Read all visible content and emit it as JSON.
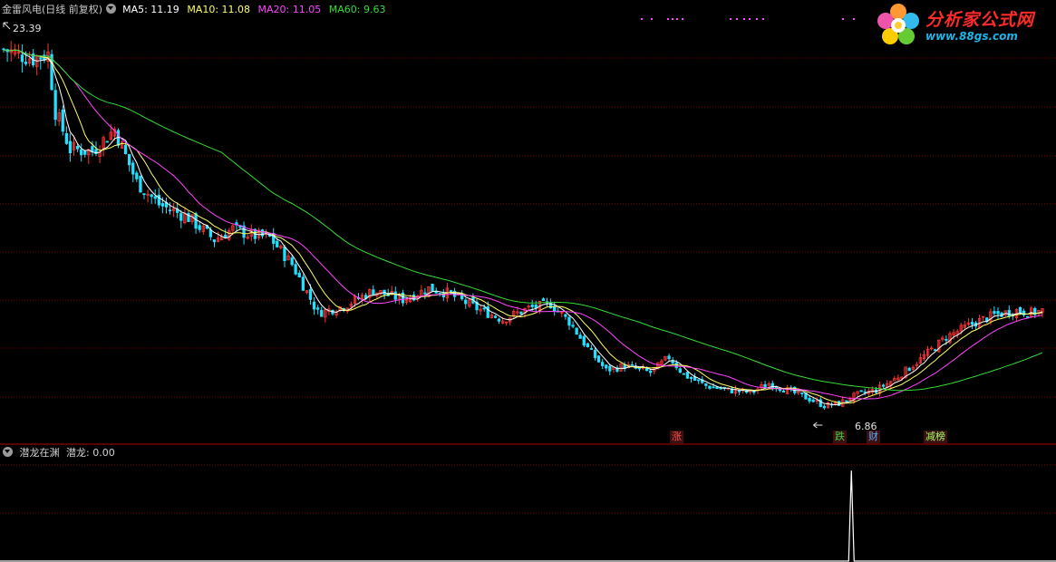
{
  "header": {
    "stock_name": "金雷风电(日线 前复权)",
    "ma5_label": "MA5: 11.19",
    "ma10_label": "MA10: 11.08",
    "ma20_label": "MA20: 11.05",
    "ma60_label": "MA60: 9.63"
  },
  "lower_header": {
    "indicator_name": "潜龙在渊",
    "value_label": "潜龙: 0.00"
  },
  "logo": {
    "title": "分析家公式网",
    "url": "www.88gs.com"
  },
  "annotations": {
    "high_label": "23.39",
    "low_label": "6.86"
  },
  "signals": [
    {
      "text": "涨",
      "color": "#ff5050"
    },
    {
      "text": "跌",
      "color": "#3cd03c"
    },
    {
      "text": "财",
      "color": "#5ab0ff"
    },
    {
      "text": "减榜",
      "color": "#a0ff60"
    }
  ],
  "colors": {
    "up": "#ff3333",
    "down": "#22e0ff",
    "ma5": "#ffffff",
    "ma10": "#ffff66",
    "ma20": "#ff44ff",
    "ma60": "#33dd33",
    "grid": "#7a0000",
    "panel_border": "#b00000",
    "indicator": "#ffffff",
    "flag_dots": "#ff44ff"
  },
  "chart_data": [
    {
      "type": "candlestick",
      "title": "金雷风电(日线 前复权)",
      "ylim": [
        5.2,
        24.5
      ],
      "high": 23.39,
      "low": 6.86,
      "ma_latest": {
        "MA5": 11.19,
        "MA10": 11.08,
        "MA20": 11.05,
        "MA60": 9.63
      },
      "keypoints": [
        [
          0,
          23.0
        ],
        [
          8,
          22.6
        ],
        [
          12,
          22.8
        ],
        [
          14,
          20.2
        ],
        [
          18,
          18.5
        ],
        [
          24,
          18.4
        ],
        [
          30,
          19.4
        ],
        [
          36,
          17.0
        ],
        [
          42,
          16.0
        ],
        [
          50,
          15.4
        ],
        [
          57,
          14.4
        ],
        [
          62,
          14.9
        ],
        [
          67,
          14.6
        ],
        [
          72,
          14.5
        ],
        [
          78,
          13.3
        ],
        [
          85,
          11.1
        ],
        [
          92,
          11.4
        ],
        [
          100,
          12.1
        ],
        [
          108,
          11.7
        ],
        [
          115,
          12.2
        ],
        [
          120,
          12.0
        ],
        [
          128,
          11.3
        ],
        [
          135,
          10.8
        ],
        [
          142,
          11.3
        ],
        [
          148,
          11.5
        ],
        [
          153,
          10.7
        ],
        [
          158,
          9.5
        ],
        [
          163,
          8.5
        ],
        [
          168,
          8.7
        ],
        [
          175,
          8.4
        ],
        [
          180,
          9.1
        ],
        [
          184,
          8.3
        ],
        [
          190,
          7.8
        ],
        [
          196,
          7.6
        ],
        [
          202,
          7.5
        ],
        [
          207,
          7.9
        ],
        [
          212,
          7.6
        ],
        [
          218,
          7.2
        ],
        [
          222,
          6.9
        ],
        [
          226,
          7.0
        ],
        [
          231,
          7.4
        ],
        [
          236,
          7.6
        ],
        [
          241,
          8.1
        ],
        [
          248,
          9.0
        ],
        [
          255,
          10.0
        ],
        [
          262,
          10.6
        ],
        [
          268,
          11.0
        ],
        [
          274,
          11.2
        ],
        [
          278,
          11.1
        ],
        [
          281,
          11.19
        ]
      ]
    },
    {
      "type": "line",
      "title": "潜龙在渊",
      "series": [
        {
          "name": "潜龙",
          "last_value": 0.0
        }
      ],
      "spike_position": 0.815,
      "spike_value": 1,
      "ylim": [
        0,
        1.1
      ]
    }
  ]
}
